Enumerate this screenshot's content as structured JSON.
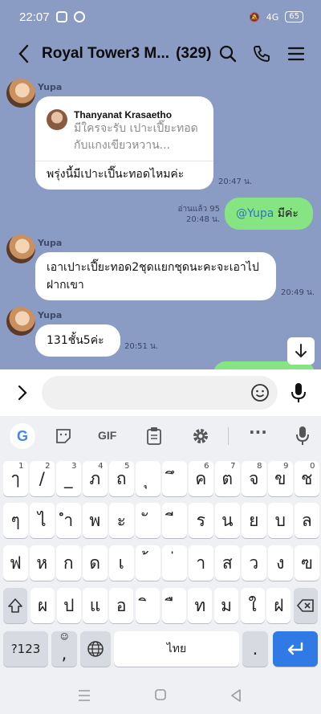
{
  "status": {
    "time": "22:07",
    "battery": "65",
    "signal": "4G"
  },
  "header": {
    "title": "Royal Tower3 M...",
    "member_count": "(329)"
  },
  "messages": [
    {
      "sender": "Yupa",
      "reply_to_name": "Thanyanat Krasaetho",
      "reply_to_text": "มีใครจะรับ เปาะเปี๊ยะทอด กับแกงเขียวหวาน...",
      "text": "พรุ่งนี้มีเปาะเปี๊นะทอดไหมค่ะ",
      "time": "20:47 น."
    },
    {
      "mention": "@Yupa",
      "text": " มีค่ะ",
      "read": "อ่านแล้ว 95",
      "time": "20:48 น."
    },
    {
      "sender": "Yupa",
      "text": "เอาเปาะเปี๊ยะทอด2ชุดแยกชุดนะคะจะเอาไปฝากเขา",
      "time": "20:49 น."
    },
    {
      "sender": "Yupa",
      "text": "131ชั้น5ค่ะ",
      "time": "20:51 น."
    }
  ],
  "toolbar": {
    "gif": "GIF"
  },
  "keyboard": {
    "row1": [
      {
        "k": "ๅ",
        "h": "1"
      },
      {
        "k": "/",
        "h": "2"
      },
      {
        "k": "_",
        "h": "3"
      },
      {
        "k": "ภ",
        "h": "4"
      },
      {
        "k": "ถ",
        "h": "5"
      },
      {
        "k": "ุ",
        "h": ""
      },
      {
        "k": "ึ",
        "h": ""
      },
      {
        "k": "ค",
        "h": "6"
      },
      {
        "k": "ต",
        "h": "7"
      },
      {
        "k": "จ",
        "h": "8"
      },
      {
        "k": "ข",
        "h": "9"
      },
      {
        "k": "ช",
        "h": "0"
      }
    ],
    "row2": [
      "ๆ",
      "ไ",
      "ำ",
      "พ",
      "ะ",
      "ั",
      "ี",
      "ร",
      "น",
      "ย",
      "บ",
      "ล"
    ],
    "row3": [
      "ฟ",
      "ห",
      "ก",
      "ด",
      "เ",
      "้",
      "่",
      "า",
      "ส",
      "ว",
      "ง",
      "ฃ"
    ],
    "row4": [
      "ผ",
      "ป",
      "แ",
      "อ",
      "ิ",
      "ื",
      "ท",
      "ม",
      "ใ",
      "ฝ"
    ],
    "num_key": "?123",
    "comma_key": ",",
    "comma_hint": "☺",
    "space_label": "ไทย",
    "period_key": "."
  }
}
